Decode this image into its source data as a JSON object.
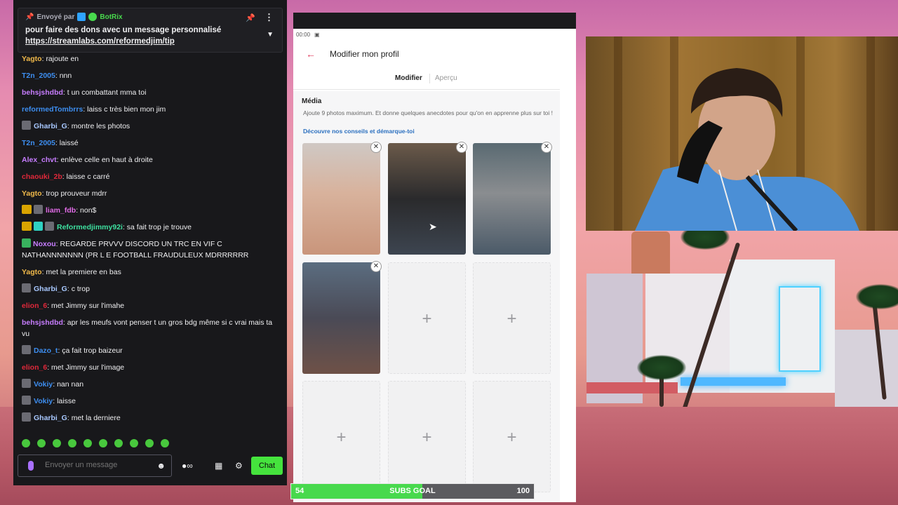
{
  "pinned": {
    "sent_by": "Envoyé par",
    "sender": "BotRix",
    "text": "pour faire des dons avec un message personnalisé",
    "link": "https://streamlabs.com/reformedjim/tip"
  },
  "messages": [
    {
      "user": "Yagto",
      "color": "#f0b94a",
      "text": "rajoute en",
      "badge": "none"
    },
    {
      "user": "T2n_2005",
      "color": "#3d8ef0",
      "text": "nnn",
      "badge": "none"
    },
    {
      "user": "behsjshdbd",
      "color": "#c77dff",
      "text": "t un combattant mma toi",
      "badge": "none"
    },
    {
      "user": "reformedTombrrs",
      "color": "#3d8ef0",
      "text": "laiss c très bien mon jim",
      "badge": "none"
    },
    {
      "user": "Gharbi_G",
      "color": "#a8c8ff",
      "text": "montre les photos",
      "badge": "avatar"
    },
    {
      "user": "T2n_2005",
      "color": "#3d8ef0",
      "text": "laissé",
      "badge": "none"
    },
    {
      "user": "Alex_chvt",
      "color": "#c77dff",
      "text": "enlève celle en haut à droite",
      "badge": "none"
    },
    {
      "user": "chaouki_2b",
      "color": "#e0283a",
      "text": "laisse c carré",
      "badge": "none"
    },
    {
      "user": "Yagto",
      "color": "#f0b94a",
      "text": "trop prouveur mdrr",
      "badge": "none"
    },
    {
      "user": "liam_fdb",
      "color": "#e06be6",
      "text": "non$",
      "badge": "crown"
    },
    {
      "user": "Reformedjimmy92i",
      "color": "#3ee0a0",
      "text": "sa fait trop je trouve",
      "badge": "crown-sub"
    },
    {
      "user": "Noxou",
      "color": "#c77dff",
      "text": "REGARDE PRVVV DISCORD UN TRC EN VIF C NATHANNNNNNN (PR L E FOOTBALL FRAUDULEUX MDRRRRRR",
      "badge": "sub"
    },
    {
      "user": "Yagto",
      "color": "#f0b94a",
      "text": "met la premiere en bas",
      "badge": "none"
    },
    {
      "user": "Gharbi_G",
      "color": "#a8c8ff",
      "text": "c trop",
      "badge": "avatar"
    },
    {
      "user": "elion_6",
      "color": "#e0283a",
      "text": "met Jimmy sur l'imahe",
      "badge": "none"
    },
    {
      "user": "behsjshdbd",
      "color": "#c77dff",
      "text": "apr les meufs vont penser t un gros bdg même si c vrai mais ta vu",
      "badge": "none"
    },
    {
      "user": "Dazo_t",
      "color": "#3d8ef0",
      "text": "ça fait trop baizeur",
      "badge": "avatar"
    },
    {
      "user": "elion_6",
      "color": "#e0283a",
      "text": "met Jimmy sur l'image",
      "badge": "none"
    },
    {
      "user": "Vokiy",
      "color": "#3d8ef0",
      "text": "nan nan",
      "badge": "avatar"
    },
    {
      "user": "Vokiy",
      "color": "#3d8ef0",
      "text": "laisse",
      "badge": "avatar"
    },
    {
      "user": "Gharbi_G",
      "color": "#a8c8ff",
      "text": "met la derniere",
      "badge": "avatar"
    }
  ],
  "chat_input": {
    "placeholder": "Envoyer un message",
    "send_label": "Chat"
  },
  "phone": {
    "time": "00:00",
    "title": "Modifier mon profil",
    "tabs": [
      "Modifier",
      "Aperçu"
    ],
    "media_title": "Média",
    "media_desc": "Ajoute 9 photos maximum. Et donne quelques anecdotes pour qu'on en apprenne plus sur toi !",
    "media_link": "Découvre nos conseils et démarque-toi",
    "photo_count": 4,
    "slot_count": 9
  },
  "goal": {
    "current": "54",
    "label": "SUBS GOAL",
    "target": "100",
    "current_value": 54,
    "target_value": 100
  },
  "colors": {
    "accent_chat": "#45e33d",
    "accent_app": "#e03a5c",
    "link": "#2a6fbf"
  }
}
